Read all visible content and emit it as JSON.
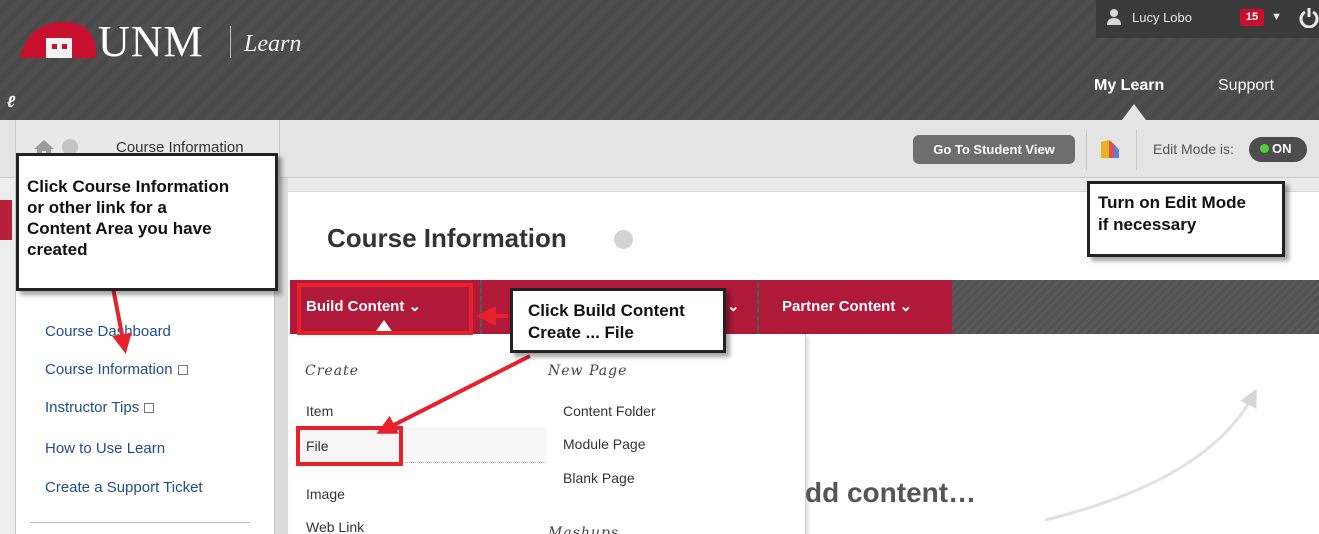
{
  "header": {
    "logo_text": "UNM",
    "logo_sub": "Learn",
    "user_name": "Lucy Lobo",
    "notification_count": "15",
    "tabs": [
      {
        "label": "My Learn",
        "active": true
      },
      {
        "label": "Support",
        "active": false
      }
    ]
  },
  "breadcrumb": {
    "current": "Course Information"
  },
  "edit_bar": {
    "student_view_label": "Go To Student View",
    "edit_mode_label": "Edit Mode is:",
    "edit_mode_value": "ON"
  },
  "left_menu": {
    "items": [
      {
        "label": "Course Dashboard",
        "has_mark": false
      },
      {
        "label": "Course Information",
        "has_mark": true
      },
      {
        "label": "Instructor Tips",
        "has_mark": true
      },
      {
        "label": "How to Use Learn",
        "has_mark": false
      },
      {
        "label": "Create a Support Ticket",
        "has_mark": false
      }
    ]
  },
  "content": {
    "page_title": "Course Information",
    "action_bar": {
      "build_content": "Build Content",
      "partner_content": "Partner Content"
    },
    "dropdown": {
      "create_heading": "Create",
      "create_items": [
        "Item",
        "File",
        "Image",
        "Web Link"
      ],
      "new_page_heading": "New Page",
      "new_page_items": [
        "Content Folder",
        "Module Page",
        "Blank Page"
      ],
      "mashups_heading": "Mashups"
    },
    "empty_hint": "dd content…"
  },
  "callouts": {
    "course_info": [
      "Click Course Information",
      "or other link for a",
      "Content Area you have",
      "created"
    ],
    "edit_mode": [
      "Turn on Edit Mode",
      "if necessary"
    ],
    "build_content": [
      "Click Build Content",
      "Create ... File"
    ]
  },
  "colors": {
    "header_bg": "#4b4b4b",
    "accent_red": "#b0193a",
    "annotation_red": "#e8202a",
    "link_blue": "#1f4e8c",
    "toggle_green": "#4cd038"
  }
}
